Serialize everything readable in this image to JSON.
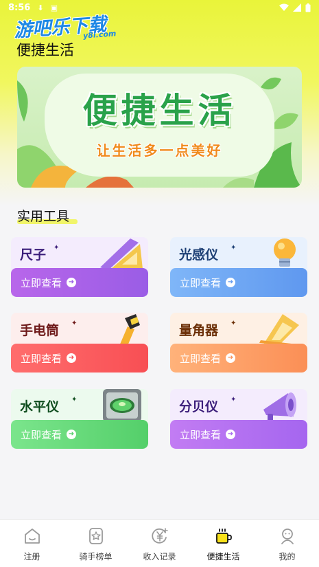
{
  "status_bar": {
    "time": "8:56"
  },
  "watermark": {
    "brand": "游吧乐下载",
    "domain": "y8l.com"
  },
  "page": {
    "title": "便捷生活"
  },
  "banner": {
    "title": "便捷生活",
    "subtitle": "让生活多一点美好"
  },
  "tools_section": {
    "title": "实用工具"
  },
  "tools": [
    {
      "name": "尺子",
      "button": "立即查看",
      "title_color": "#3b1e7a",
      "btn_gradient": [
        "#b866ea",
        "#9a5de6"
      ],
      "bg": "#f4ecfd",
      "icon": "ruler-icon"
    },
    {
      "name": "光感仪",
      "button": "立即查看",
      "title_color": "#1d3f74",
      "btn_gradient": [
        "#7fb6f8",
        "#5f98ef"
      ],
      "bg": "#e8f1fd",
      "icon": "light-bulb-icon"
    },
    {
      "name": "手电筒",
      "button": "立即查看",
      "title_color": "#6e1a1a",
      "btn_gradient": [
        "#ff6d6d",
        "#f84f54"
      ],
      "bg": "#fdeeed",
      "icon": "flashlight-icon"
    },
    {
      "name": "量角器",
      "button": "立即查看",
      "title_color": "#6b2f07",
      "btn_gradient": [
        "#ffb27a",
        "#fb8f56"
      ],
      "bg": "#fef0e4",
      "icon": "protractor-icon"
    },
    {
      "name": "水平仪",
      "button": "立即查看",
      "title_color": "#0f4d1e",
      "btn_gradient": [
        "#7be58c",
        "#54cf6a"
      ],
      "bg": "#ecfaee",
      "icon": "spirit-level-icon"
    },
    {
      "name": "分贝仪",
      "button": "立即查看",
      "title_color": "#3b1e7a",
      "btn_gradient": [
        "#c27cf3",
        "#a566ef"
      ],
      "bg": "#f4ecfd",
      "icon": "megaphone-icon"
    }
  ],
  "tabbar": {
    "items": [
      {
        "label": "注册",
        "icon": "home-icon"
      },
      {
        "label": "骑手榜单",
        "icon": "star-badge-icon"
      },
      {
        "label": "收入记录",
        "icon": "yen-coin-icon"
      },
      {
        "label": "便捷生活",
        "icon": "cup-icon",
        "active": true
      },
      {
        "label": "我的",
        "icon": "profile-icon"
      }
    ]
  }
}
